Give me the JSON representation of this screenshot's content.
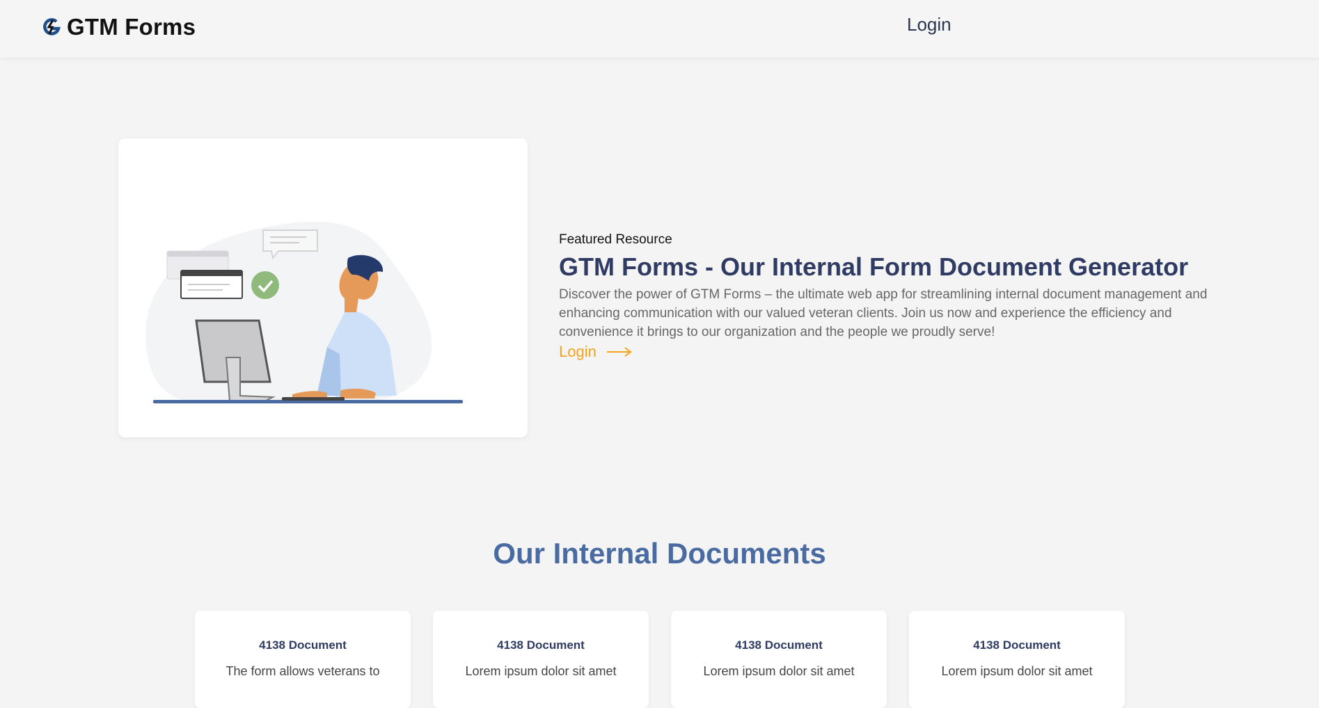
{
  "header": {
    "brand_name": "GTM Forms",
    "login_label": "Login"
  },
  "hero": {
    "featured_label": "Featured Resource",
    "title": "GTM Forms - Our Internal Form Document Generator",
    "description": "Discover the power of GTM Forms – the ultimate web app for streamlining internal document management and enhancing communication with our valued veteran clients. Join us now and experience the efficiency and convenience it brings to our organization and the people we proudly serve!",
    "login_label": "Login"
  },
  "section": {
    "title": "Our Internal Documents"
  },
  "documents": [
    {
      "title": "4138 Document",
      "description": "The form allows veterans to"
    },
    {
      "title": "4138 Document",
      "description": "Lorem ipsum dolor sit amet"
    },
    {
      "title": "4138 Document",
      "description": "Lorem ipsum dolor sit amet"
    },
    {
      "title": "4138 Document",
      "description": "Lorem ipsum dolor sit amet"
    }
  ],
  "colors": {
    "brand_title": "#2f3b63",
    "accent": "#f4a41c",
    "section_title": "#4a6aa2",
    "background": "#f4f4f4"
  },
  "icons": {
    "logo": "gtm-logo-icon",
    "arrow": "arrow-right-icon"
  }
}
